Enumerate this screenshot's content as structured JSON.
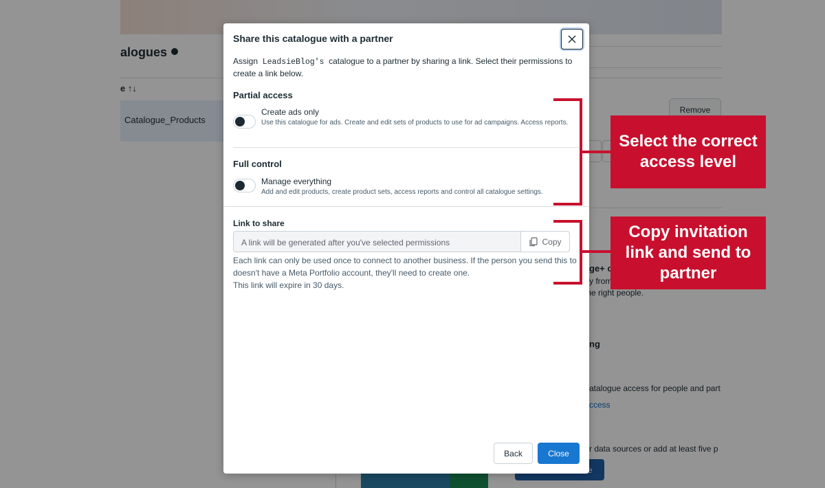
{
  "background": {
    "section_title": "alogues",
    "sort_header": "e ↑↓",
    "catalogue_row": "Catalogue_Products",
    "remove_button": "Remove",
    "partial_heading": "ge+ c",
    "partial_line1": "y from",
    "partial_line2": "the right people.",
    "heading2": "ng",
    "access_text": "atalogue access for people and part",
    "access_link": "ccess",
    "data_sources_text": "r data sources or add at least five p",
    "blue_button": "e"
  },
  "modal": {
    "title": "Share this catalogue with a partner",
    "close_icon": "close-icon",
    "description_prefix": "Assign",
    "business_name": "LeadsieBlog's",
    "description_suffix": "catalogue to a partner by sharing a link. Select their permissions to create a link below.",
    "partial_access": {
      "heading": "Partial access",
      "option_title": "Create ads only",
      "option_description": "Use this catalogue for ads. Create and edit sets of products to use for ad campaigns. Access reports."
    },
    "full_control": {
      "heading": "Full control",
      "option_title": "Manage everything",
      "option_description": "Add and edit products, create product sets, access reports and control all catalogue settings."
    },
    "link": {
      "heading": "Link to share",
      "placeholder": "A link will be generated after you've selected permissions",
      "copy_label": "Copy",
      "help_line1": "Each link can only be used once to connect to another business. If the person you send this to doesn't have a Meta Portfolio account, they'll need to create one.",
      "help_line2": "This link will expire in 30 days."
    },
    "back_label": "Back",
    "close_label": "Close"
  },
  "annotations": {
    "callout1": "Select the correct access level",
    "callout2": "Copy invitation link and send to partner",
    "color": "#c8102e"
  },
  "colors": {
    "primary_button": "#1877d0",
    "overlay": "rgba(0,0,0,0.42)"
  }
}
